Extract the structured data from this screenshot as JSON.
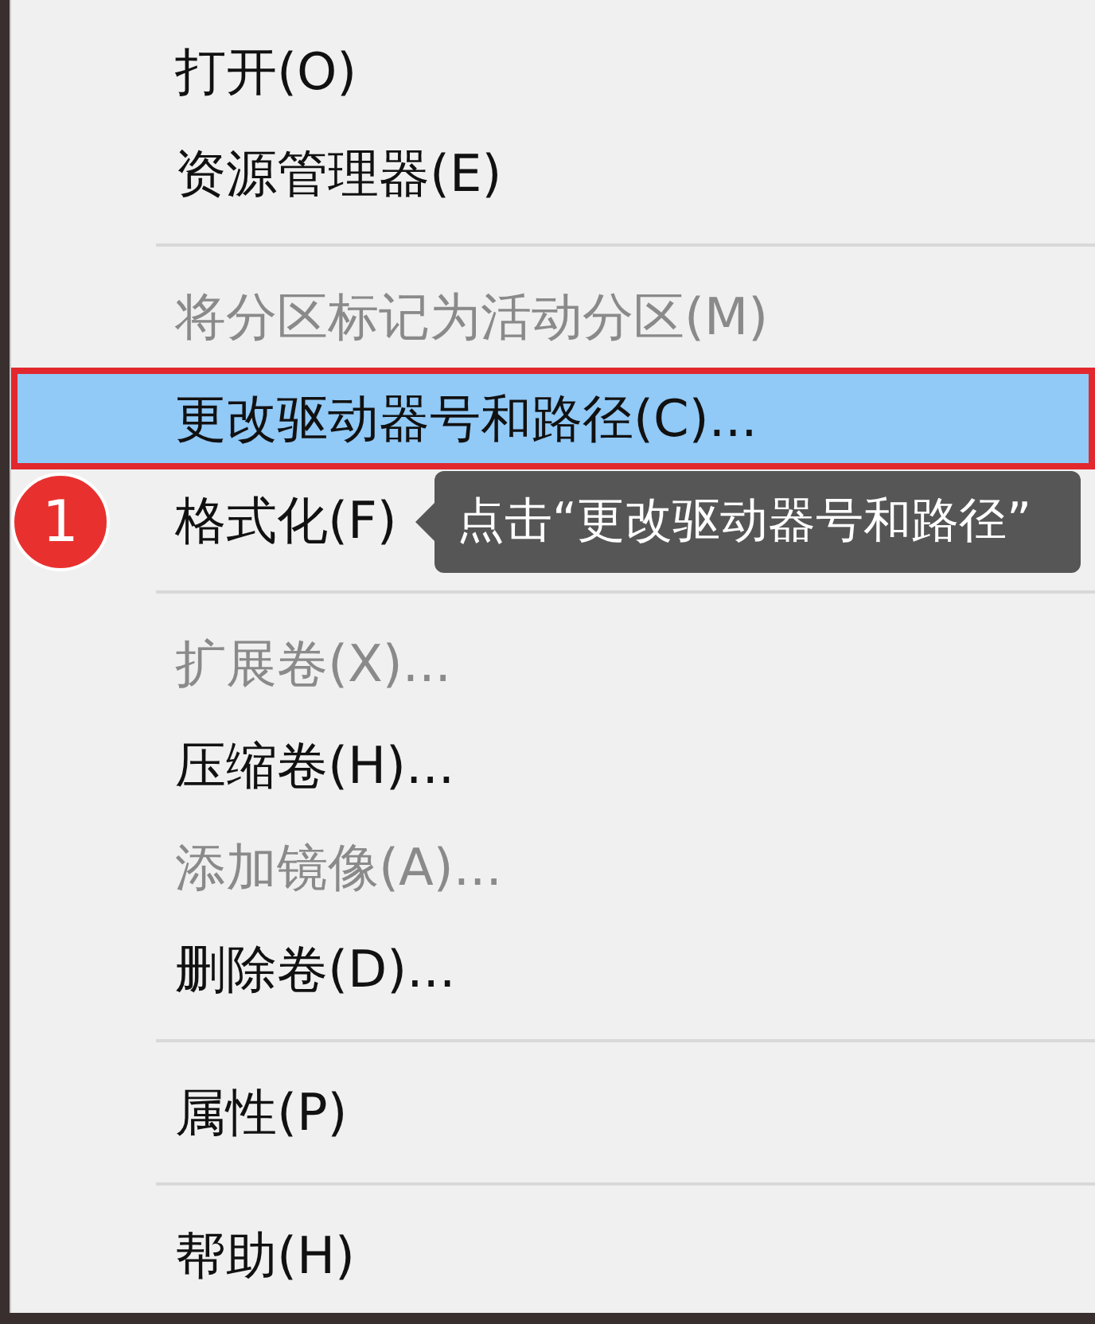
{
  "menu": {
    "items": [
      {
        "kind": "item",
        "label": "打开(O)",
        "disabled": false,
        "selected": false,
        "marked": false
      },
      {
        "kind": "item",
        "label": "资源管理器(E)",
        "disabled": false,
        "selected": false,
        "marked": false
      },
      {
        "kind": "separator"
      },
      {
        "kind": "item",
        "label": "将分区标记为活动分区(M)",
        "disabled": true,
        "selected": false,
        "marked": false
      },
      {
        "kind": "item",
        "label": "更改驱动器号和路径(C)...",
        "disabled": false,
        "selected": true,
        "marked": true
      },
      {
        "kind": "item",
        "label": "格式化(F)",
        "disabled": false,
        "selected": false,
        "marked": false
      },
      {
        "kind": "separator"
      },
      {
        "kind": "item",
        "label": "扩展卷(X)...",
        "disabled": true,
        "selected": false,
        "marked": false
      },
      {
        "kind": "item",
        "label": "压缩卷(H)...",
        "disabled": false,
        "selected": false,
        "marked": false
      },
      {
        "kind": "item",
        "label": "添加镜像(A)...",
        "disabled": true,
        "selected": false,
        "marked": false
      },
      {
        "kind": "item",
        "label": "删除卷(D)...",
        "disabled": false,
        "selected": false,
        "marked": false
      },
      {
        "kind": "separator"
      },
      {
        "kind": "item",
        "label": "属性(P)",
        "disabled": false,
        "selected": false,
        "marked": false
      },
      {
        "kind": "separator"
      },
      {
        "kind": "item",
        "label": "帮助(H)",
        "disabled": false,
        "selected": false,
        "marked": false
      }
    ]
  },
  "callout": {
    "badge": "1",
    "text": "点击“更改驱动器号和路径”"
  }
}
